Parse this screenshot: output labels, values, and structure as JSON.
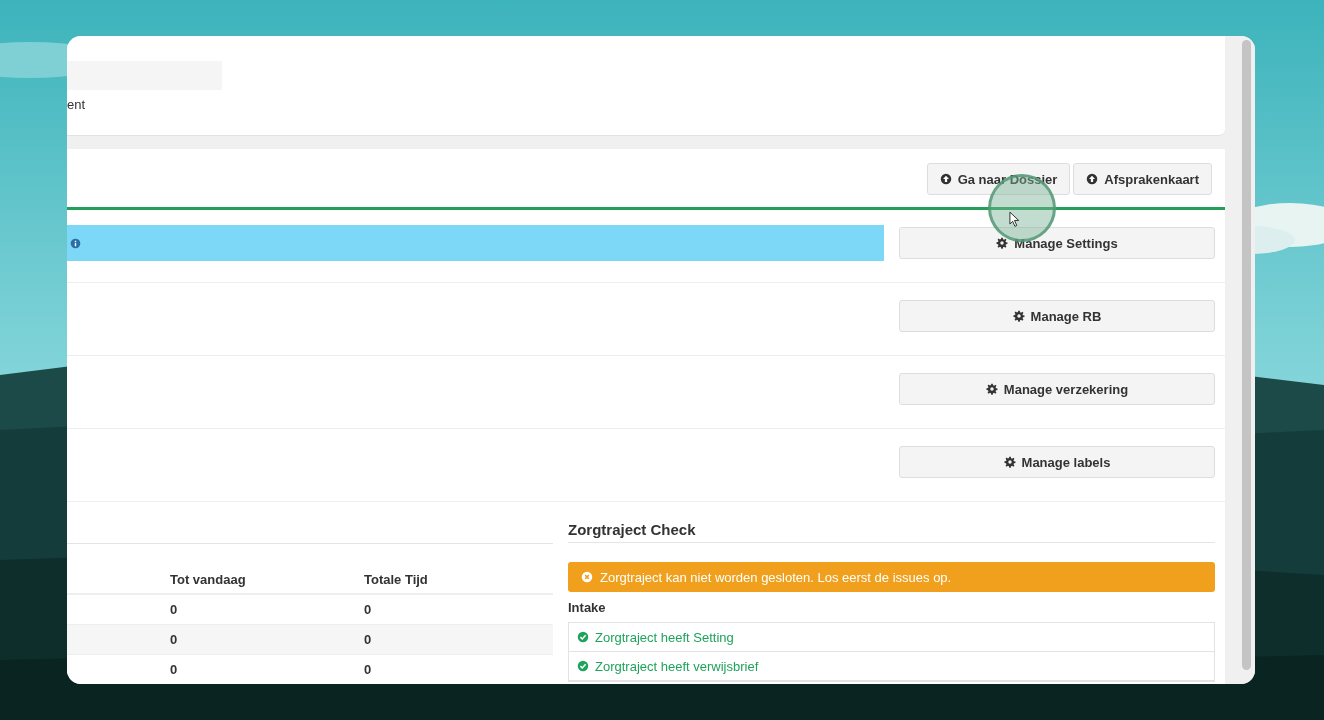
{
  "top_card": {
    "text_fragment": "ent"
  },
  "header_buttons": [
    {
      "label": "Ga naar Dossier"
    },
    {
      "label": "Afsprakenkaart"
    }
  ],
  "setting_rows": [
    {
      "button": "Manage Settings",
      "info_bar": true
    },
    {
      "button": "Manage RB",
      "info_bar": false
    },
    {
      "button": "Manage verzekering",
      "info_bar": false
    },
    {
      "button": "Manage labels",
      "info_bar": false
    }
  ],
  "time_table": {
    "columns": [
      "Tot vandaag",
      "Totale Tijd"
    ],
    "rows": [
      {
        "cells": [
          "0",
          "0"
        ]
      },
      {
        "cells": [
          "0",
          "0"
        ]
      },
      {
        "cells": [
          "0",
          "0"
        ]
      }
    ]
  },
  "check": {
    "title": "Zorgtraject Check",
    "alert": "Zorgtraject kan niet worden gesloten. Los eerst de issues op.",
    "section": "Intake",
    "items": [
      {
        "label": "Zorgtraject heeft Setting",
        "ok": true
      },
      {
        "label": "Zorgtraject heeft verwijsbrief",
        "ok": true
      }
    ]
  }
}
